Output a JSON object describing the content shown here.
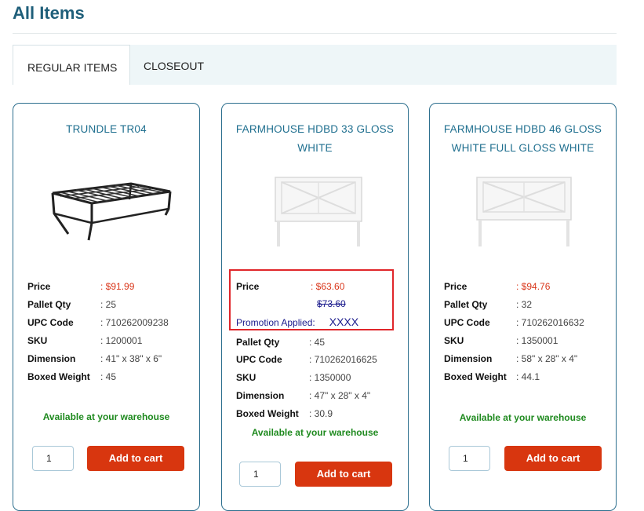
{
  "page": {
    "title": "All Items"
  },
  "tabs": [
    {
      "label": "REGULAR ITEMS",
      "active": true
    },
    {
      "label": "CLOSEOUT",
      "active": false
    }
  ],
  "labels": {
    "price": "Price",
    "pallet_qty": "Pallet Qty",
    "upc": "UPC Code",
    "sku": "SKU",
    "dimension": "Dimension",
    "boxed_weight": "Boxed Weight",
    "promotion": "Promotion Applied:"
  },
  "products": [
    {
      "name": "TRUNDLE TR04",
      "image_icon": "trundle-bed-frame-image",
      "price": ": $91.99",
      "pallet_qty": ": 25",
      "upc": ": 710262009238",
      "sku": ": 1200001",
      "dimension": ": 41\" x 38\" x 6\"",
      "boxed_weight": ": 45",
      "availability": "Available at your warehouse",
      "qty": "1",
      "cart_label": "Add to cart"
    },
    {
      "name": "FARMHOUSE HDBD 33 GLOSS WHITE",
      "image_icon": "white-headboard-image",
      "price": ": $63.60",
      "old_price": "$73.60",
      "promo_code": "XXXX",
      "pallet_qty": ": 45",
      "upc": ": 710262016625",
      "sku": ": 1350000",
      "dimension": ": 47\" x 28\" x 4\"",
      "boxed_weight": ": 30.9",
      "availability": "Available at your warehouse",
      "qty": "1",
      "cart_label": "Add to cart"
    },
    {
      "name": "FARMHOUSE HDBD 46 GLOSS WHITE FULL GLOSS WHITE",
      "image_icon": "white-headboard-image",
      "price": ": $94.76",
      "pallet_qty": ": 32",
      "upc": ": 710262016632",
      "sku": ": 1350001",
      "dimension": ": 58\" x 28\" x 4\"",
      "boxed_weight": ": 44.1",
      "availability": "Available at your warehouse",
      "qty": "1",
      "cart_label": "Add to cart"
    }
  ],
  "colors": {
    "title": "#1f5f7a",
    "card_border": "#2d6f8e",
    "price": "#d9361a",
    "promo": "#1a1a8c",
    "available": "#1f8a1f",
    "cart_button": "#d8360f",
    "highlight_box": "#e0262a"
  }
}
